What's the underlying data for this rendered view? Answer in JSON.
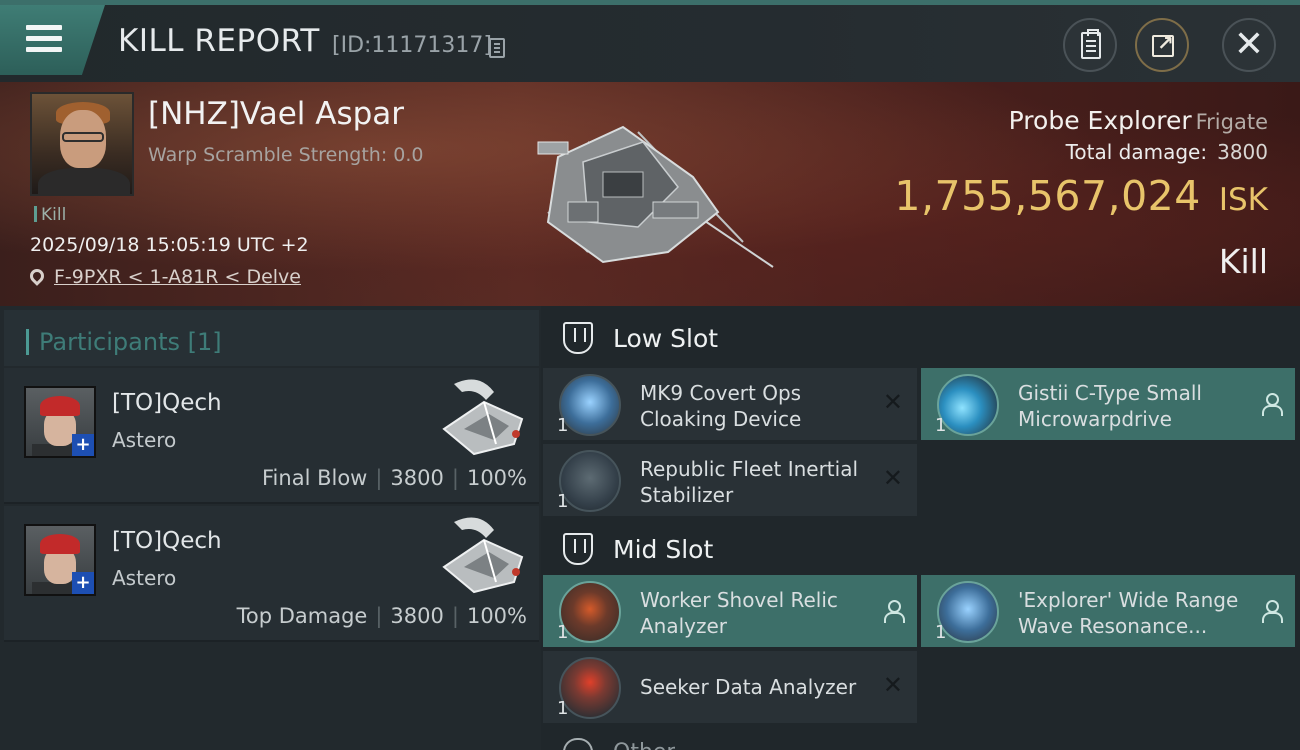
{
  "header": {
    "title": "KILL REPORT",
    "report_id": "[ID:11171317]"
  },
  "victim": {
    "name": "[NHZ]Vael Aspar",
    "warp_scramble": "Warp Scramble Strength: 0.0",
    "tag": "Kill",
    "timestamp": "2025/09/18 15:05:19 UTC +2",
    "location": "F-9PXR < 1-A81R < Delve",
    "ship_name": "Probe Explorer",
    "ship_class": "Frigate",
    "total_damage_label": "Total damage:",
    "total_damage": "3800",
    "isk_value": "1,755,567,024",
    "isk_unit": "ISK",
    "result": "Kill"
  },
  "participants": {
    "title": "Participants [1]",
    "rows": [
      {
        "name": "[TO]Qech",
        "ship": "Astero",
        "role": "Final Blow",
        "damage": "3800",
        "percent": "100%"
      },
      {
        "name": "[TO]Qech",
        "ship": "Astero",
        "role": "Top Damage",
        "damage": "3800",
        "percent": "100%"
      }
    ]
  },
  "slots": {
    "low": {
      "title": "Low Slot",
      "modules": [
        {
          "name": "MK9 Covert Ops Cloaking Device",
          "qty": "1",
          "state": "destroyed",
          "icon": "cloak-icon"
        },
        {
          "name": "Gistii C-Type Small Microwarpdrive",
          "qty": "1",
          "state": "dropped",
          "icon": "microwarpdrive-icon"
        },
        {
          "name": "Republic Fleet Inertial Stabilizer",
          "qty": "1",
          "state": "destroyed",
          "icon": "inertial-stabilizer-icon"
        }
      ]
    },
    "mid": {
      "title": "Mid Slot",
      "modules": [
        {
          "name": "Worker Shovel Relic Analyzer",
          "qty": "1",
          "state": "dropped",
          "icon": "relic-analyzer-icon"
        },
        {
          "name": "'Explorer' Wide Range Wave Resonance...",
          "qty": "1",
          "state": "dropped",
          "icon": "scan-probe-launcher-icon"
        },
        {
          "name": "Seeker Data Analyzer",
          "qty": "1",
          "state": "destroyed",
          "icon": "data-analyzer-icon"
        }
      ]
    },
    "other_title": "Other"
  },
  "glyphs": {
    "destroyed": "✕",
    "close": "✕",
    "plus": "+",
    "separator": "|"
  },
  "colors": {
    "accent_teal": "#3d6f69",
    "isk_gold": "#e8c46a",
    "banner_red": "#5a2b24"
  }
}
